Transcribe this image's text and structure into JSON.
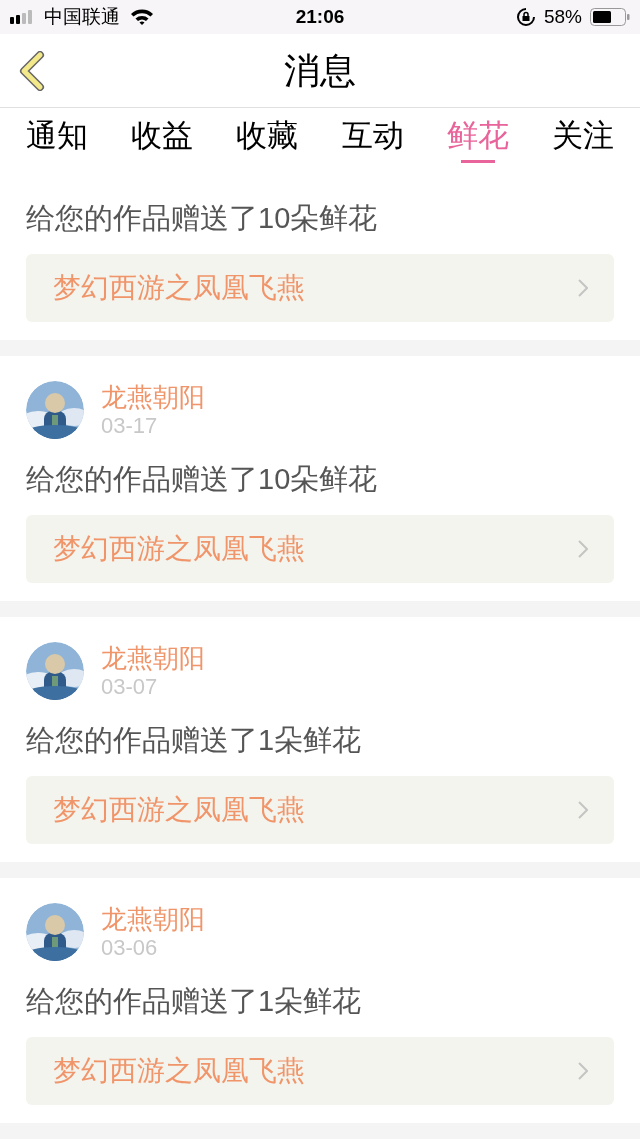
{
  "status_bar": {
    "carrier": "中国联通",
    "time": "21:06",
    "battery": "58%"
  },
  "header": {
    "title": "消息"
  },
  "tabs": [
    {
      "label": "通知",
      "selected": false
    },
    {
      "label": "收益",
      "selected": false
    },
    {
      "label": "收藏",
      "selected": false
    },
    {
      "label": "互动",
      "selected": false
    },
    {
      "label": "鲜花",
      "selected": true
    },
    {
      "label": "关注",
      "selected": false
    }
  ],
  "partial_message": {
    "message": "给您的作品赠送了10朵鲜花",
    "work": "梦幻西游之凤凰飞燕"
  },
  "messages": [
    {
      "name": "龙燕朝阳",
      "date": "03-17",
      "message": "给您的作品赠送了10朵鲜花",
      "work": "梦幻西游之凤凰飞燕"
    },
    {
      "name": "龙燕朝阳",
      "date": "03-07",
      "message": "给您的作品赠送了1朵鲜花",
      "work": "梦幻西游之凤凰飞燕"
    },
    {
      "name": "龙燕朝阳",
      "date": "03-06",
      "message": "给您的作品赠送了1朵鲜花",
      "work": "梦幻西游之凤凰飞燕"
    }
  ]
}
